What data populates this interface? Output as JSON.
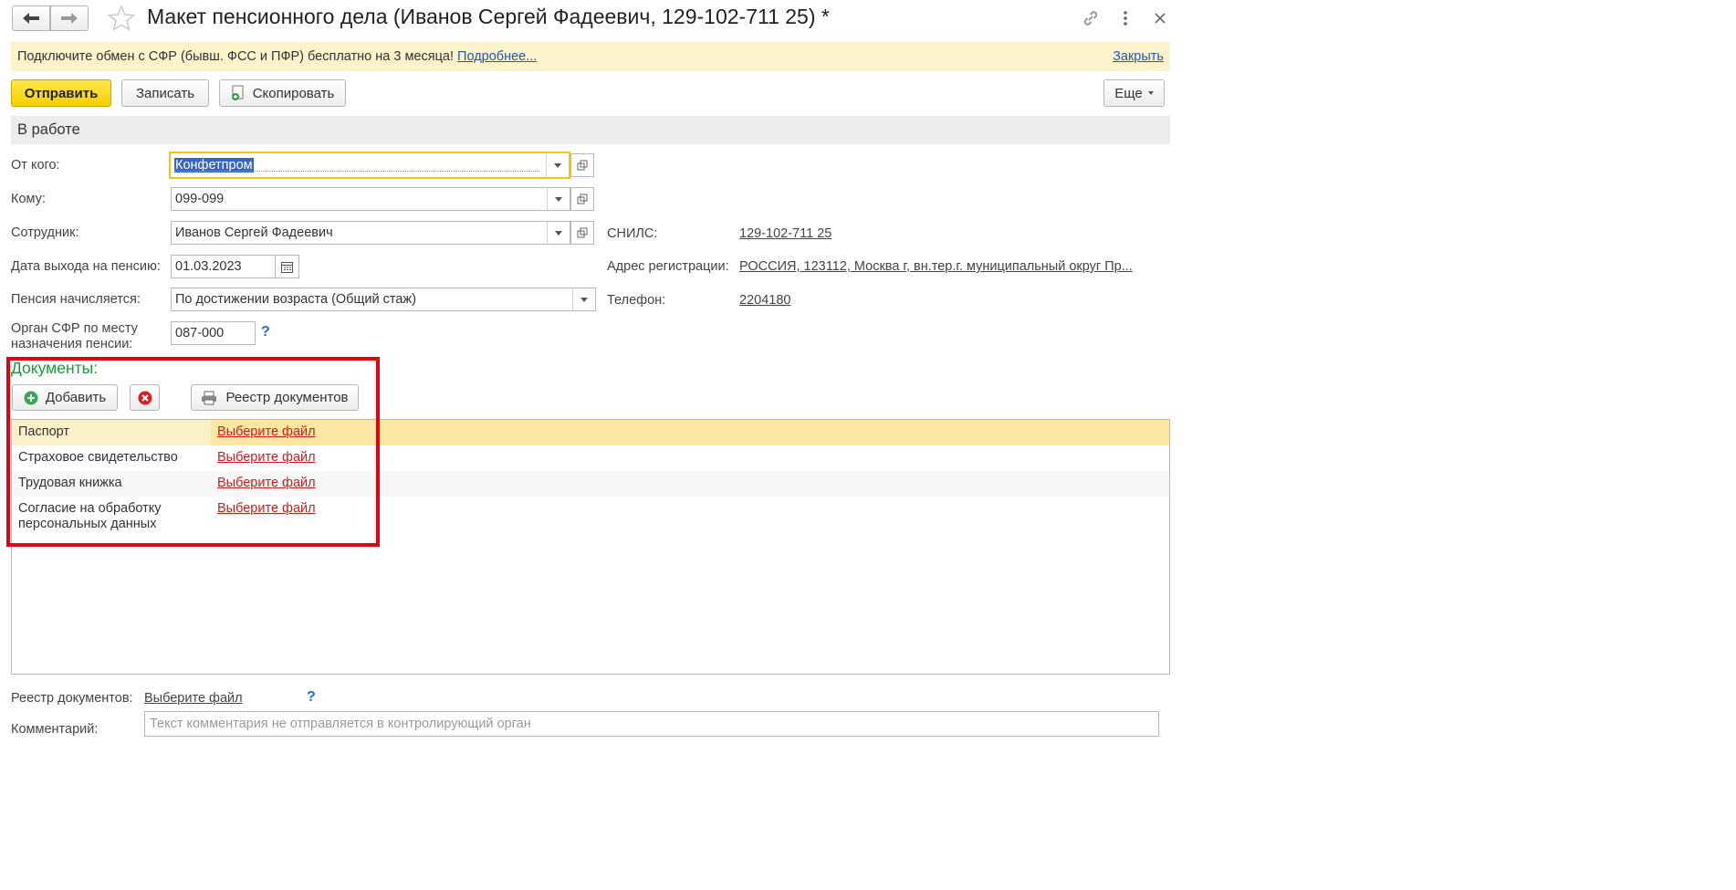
{
  "window": {
    "title": "Макет пенсионного дела (Иванов Сергей Фадеевич, 129-102-711 25) *"
  },
  "banner": {
    "text": "Подключите обмен с СФР (бывш. ФСС и ПФР) бесплатно на 3 месяца!",
    "more_link": "Подробнее...",
    "close_link": "Закрыть"
  },
  "toolbar": {
    "send_label": "Отправить",
    "save_label": "Записать",
    "copy_label": "Скопировать",
    "more_label": "Еще"
  },
  "status": {
    "label": "В работе"
  },
  "form": {
    "from_label": "От кого:",
    "from_value": "Конфетпром",
    "to_label": "Кому:",
    "to_value": "099-099",
    "employee_label": "Сотрудник:",
    "employee_value": "Иванов Сергей Фадеевич",
    "retire_date_label": "Дата выхода на пенсию:",
    "retire_date_value": "01.03.2023",
    "pension_label": "Пенсия начисляется:",
    "pension_value": "По достижении возраста (Общий стаж)",
    "sfr_label_line1": "Орган СФР по месту",
    "sfr_label_line2": "назначения пенсии:",
    "sfr_value": "087-000",
    "help": "?",
    "snils_label": "СНИЛС:",
    "snils_value": "129-102-711 25",
    "address_label": "Адрес регистрации:",
    "address_value": "РОССИЯ, 123112, Москва г, вн.тер.г. муниципальный округ Пр...",
    "phone_label": "Телефон:",
    "phone_value": "2204180"
  },
  "documents": {
    "title": "Документы:",
    "add_label": "Добавить",
    "registry_label": "Реестр документов",
    "rows": [
      {
        "name": "Паспорт",
        "file": "Выберите файл"
      },
      {
        "name": "Страховое свидетельство",
        "file": "Выберите файл"
      },
      {
        "name": "Трудовая книжка",
        "file": "Выберите файл"
      },
      {
        "name": "Согласие на обработку",
        "name2": "персональных данных",
        "file": "Выберите файл"
      }
    ]
  },
  "footer": {
    "registry_label": "Реестр документов:",
    "registry_link": "Выберите файл",
    "help": "?",
    "comment_label": "Комментарий:",
    "comment_placeholder": "Текст комментария не отправляется в контролирующий орган"
  },
  "colors": {
    "accent_yellow": "#f5cf00",
    "banner_bg": "#fbf3c9",
    "link_blue": "#1f58b5",
    "link_red": "#d21c1c",
    "docs_green": "#1a9a3a",
    "highlight_red_box": "#e3000f",
    "selected_row": "#fbe7a2"
  }
}
